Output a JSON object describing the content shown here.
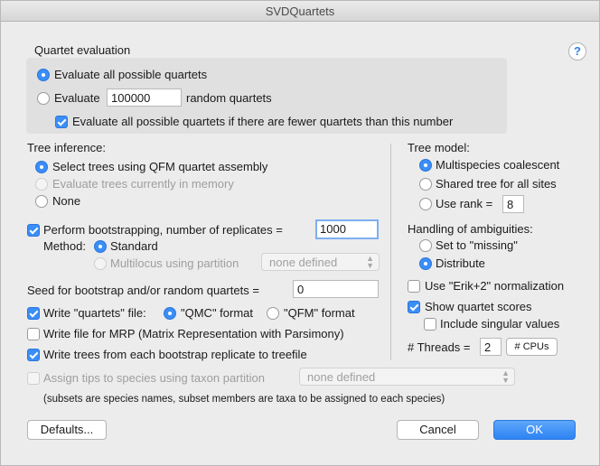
{
  "window": {
    "title": "SVDQuartets"
  },
  "quartet_evaluation": {
    "heading": "Quartet evaluation",
    "opt_all": "Evaluate all possible quartets",
    "opt_random_prefix": "Evaluate",
    "random_value": "100000",
    "opt_random_suffix": "random quartets",
    "fewer_label": "Evaluate all possible quartets if there are fewer quartets than this number"
  },
  "tree_inference": {
    "heading": "Tree inference:",
    "opt_qfm": "Select trees using QFM quartet assembly",
    "opt_memory": "Evaluate trees currently in memory",
    "opt_none": "None"
  },
  "bootstrap": {
    "label": "Perform bootstrapping, number of replicates =",
    "replicates": "1000",
    "method_label": "Method:",
    "method_standard": "Standard",
    "method_multilocus": "Multilocus using partition",
    "partition_popup": "none defined"
  },
  "seed": {
    "label": "Seed for bootstrap and/or random quartets =",
    "value": "0"
  },
  "output": {
    "write_quartets": "Write \"quartets\" file:",
    "qmc_format": "\"QMC\" format",
    "qfm_format": "\"QFM\" format",
    "write_mrp": "Write file for MRP (Matrix Representation with Parsimony)",
    "write_trees": "Write trees from each bootstrap replicate to treefile"
  },
  "species": {
    "label": "Assign tips to species using taxon partition",
    "popup": "none defined",
    "note": "(subsets are species names, subset members are taxa to be assigned to each species)"
  },
  "tree_model": {
    "heading": "Tree model:",
    "opt_multispecies": "Multispecies coalescent",
    "opt_shared": "Shared tree for all sites",
    "opt_rank": "Use rank =",
    "rank_value": "8"
  },
  "ambiguities": {
    "heading": "Handling of ambiguities:",
    "opt_missing": "Set to \"missing\"",
    "opt_distribute": "Distribute"
  },
  "options": {
    "erik": "Use \"Erik+2\" normalization",
    "show_scores": "Show quartet scores",
    "singular": "Include singular values",
    "threads_label": "# Threads =",
    "threads_value": "2",
    "cpus_button": "# CPUs"
  },
  "buttons": {
    "help": "?",
    "defaults": "Defaults...",
    "cancel": "Cancel",
    "ok": "OK"
  },
  "colors": {
    "accent": "#3b8ef6",
    "background": "#ececec",
    "group": "#e0e0e0"
  }
}
